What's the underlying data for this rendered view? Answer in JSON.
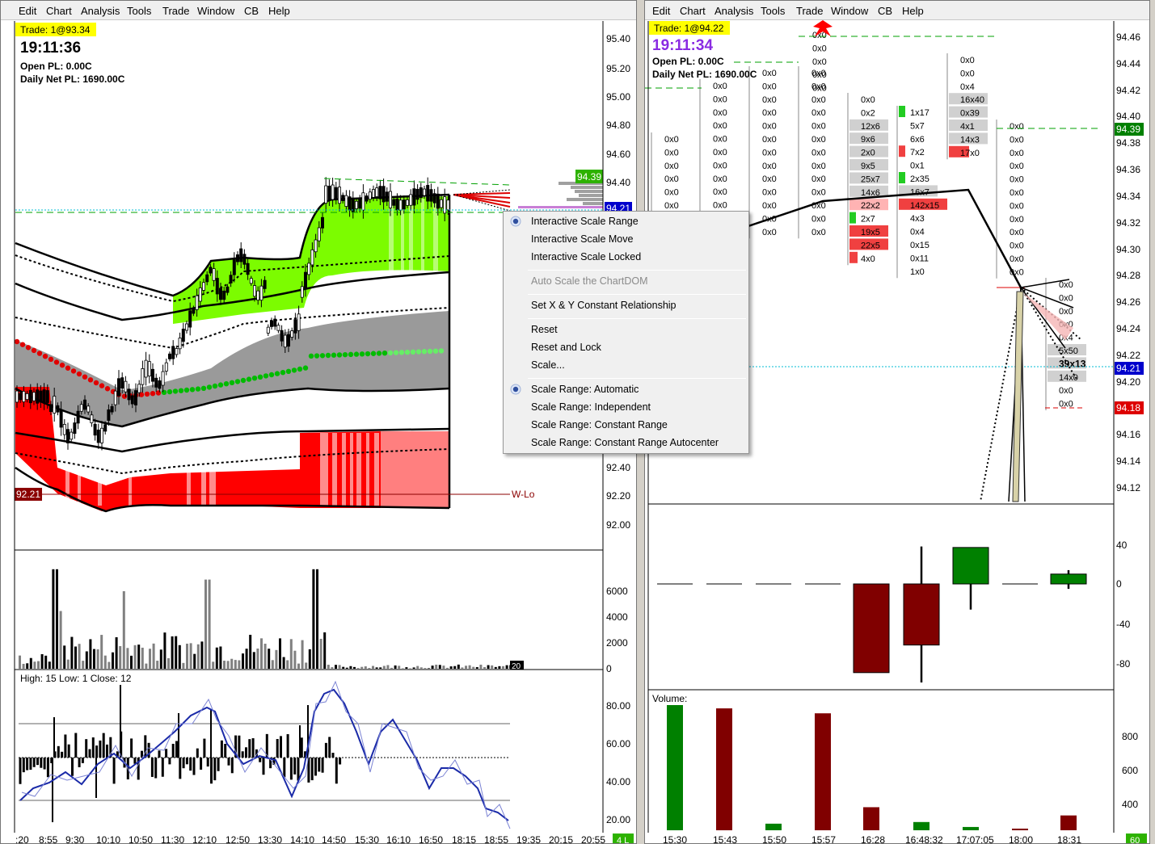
{
  "left_window": {
    "menu": [
      "Edit",
      "Chart",
      "Analysis",
      "Tools",
      "Trade",
      "Window",
      "CB",
      "Help"
    ],
    "trade_badge": "Trade: 1@93.34",
    "clock": "19:11:36",
    "open_pl": "Open PL: 0.00C",
    "daily_net_pl": "Daily Net PL: 1690.00C",
    "price_axis": [
      "95.40",
      "95.20",
      "95.00",
      "94.80",
      "94.60",
      "94.40",
      "92.40",
      "92.20",
      "92.00"
    ],
    "price_badge_green": "94.39",
    "price_badge_blue": "94.21",
    "left_axis_badge": "92.21",
    "wlo_label": "W-Lo",
    "volume_axis": [
      "6000",
      "4000",
      "2000",
      "0"
    ],
    "volume_badge": "20",
    "osc_header": "High: 15   Low: 1   Close: 12",
    "osc_axis": [
      "80.00",
      "60.00",
      "40.00",
      "20.00"
    ],
    "time_axis": [
      ":20",
      "8:55",
      "9:30",
      "10:10",
      "10:50",
      "11:30",
      "12:10",
      "12:50",
      "13:30",
      "14:10",
      "14:50",
      "15:30",
      "16:10",
      "16:50",
      "18:15",
      "18:55",
      "19:35",
      "20:15",
      "20:55"
    ],
    "status_badge": "4 L"
  },
  "right_window": {
    "menu": [
      "Edit",
      "Chart",
      "Analysis",
      "Tools",
      "Trade",
      "Window",
      "CB",
      "Help"
    ],
    "trade_badge": "Trade: 1@94.22",
    "clock": "19:11:34",
    "open_pl": "Open PL: 0.00C",
    "daily_net_pl": "Daily Net PL: 1690.00C",
    "price_axis": [
      "94.46",
      "94.44",
      "94.42",
      "94.40",
      "94.38",
      "94.36",
      "94.34",
      "94.32",
      "94.30",
      "94.28",
      "94.26",
      "94.24",
      "94.22",
      "94.20",
      "94.16",
      "94.14",
      "94.12"
    ],
    "badge_green": "94.39",
    "badge_blue": "94.21",
    "badge_red": "94.18",
    "delta_axis": [
      "40",
      "0",
      "-40",
      "-80"
    ],
    "volume_label": "Volume:",
    "volume_axis": [
      "800",
      "600",
      "400"
    ],
    "time_axis": [
      "15:30",
      "15:43",
      "15:50",
      "15:57",
      "16:28",
      "16:48:32",
      "17:07:05",
      "18:00",
      "18:31"
    ],
    "status_badge": "60",
    "footprint_columns": [
      {
        "cells": [
          "0x0",
          "0x0",
          "0x0",
          "0x0",
          "0x0",
          "0x0"
        ]
      },
      {
        "cells": [
          "0x0",
          "0x0",
          "0x0",
          "0x0",
          "0x0",
          "0x0",
          "0x0",
          "0x0",
          "0x0",
          "0x0",
          "0x0"
        ]
      },
      {
        "cells": [
          "0x0",
          "0x0",
          "0x0",
          "0x0",
          "0x0",
          "0x0",
          "0x0",
          "0x0",
          "0x0",
          "0x0",
          "0x0",
          "0x0",
          "0x0"
        ]
      },
      {
        "cells": [
          "0x0",
          "0x0",
          "0x0",
          "0x0",
          "0x0",
          "0x0",
          "0x0",
          "0x0",
          "0x0",
          "0x0",
          "0x0",
          "0x0",
          "0x0"
        ]
      },
      {
        "cells": [
          "0x0",
          "0x2",
          "12x6",
          "9x6",
          "2x0",
          "9x5",
          "25x7",
          "14x6",
          "22x2",
          "2x7",
          "19x5",
          "22x5",
          "4x0"
        ]
      },
      {
        "cells": [
          "1x17",
          "5x7",
          "6x6",
          "7x2",
          "0x1",
          "2x35",
          "16x7",
          "142x15",
          "4x3",
          "0x4",
          "0x15",
          "0x11",
          "1x0"
        ]
      },
      {
        "cells": [
          "0x0",
          "0x0",
          "0x4",
          "16x40",
          "0x39",
          "4x1",
          "14x3",
          "17x0"
        ]
      },
      {
        "cells": [
          "0x0",
          "0x0",
          "0x0",
          "0x0",
          "0x0",
          "0x0",
          "0x0",
          "0x0",
          "0x0",
          "0x0",
          "0x0",
          "0x0"
        ]
      },
      {
        "cells": [
          "0x0",
          "0x0",
          "0x0",
          "0x0",
          "0x4",
          "5x50",
          "39x13",
          "14x0",
          "0x0",
          "0x0"
        ]
      }
    ],
    "top_column": [
      "0x0",
      "0x0",
      "0x0",
      "0x0",
      "0x0"
    ]
  },
  "context_menu": {
    "items": [
      {
        "label": "Interactive Scale Range",
        "checked": true,
        "disabled": false
      },
      {
        "label": "Interactive Scale Move",
        "checked": false,
        "disabled": false
      },
      {
        "label": "Interactive Scale Locked",
        "checked": false,
        "disabled": false
      },
      {
        "label": "Auto Scale the ChartDOM",
        "checked": false,
        "disabled": true
      },
      {
        "label": "Set X & Y Constant Relationship",
        "checked": false,
        "disabled": false
      },
      {
        "label": "Reset",
        "checked": false,
        "disabled": false
      },
      {
        "label": "Reset and Lock",
        "checked": false,
        "disabled": false
      },
      {
        "label": "Scale...",
        "checked": false,
        "disabled": false
      },
      {
        "label": "Scale Range: Automatic",
        "checked": true,
        "disabled": false
      },
      {
        "label": "Scale Range: Independent",
        "checked": false,
        "disabled": false
      },
      {
        "label": "Scale Range: Constant Range",
        "checked": false,
        "disabled": false
      },
      {
        "label": "Scale Range: Constant Range Autocenter",
        "checked": false,
        "disabled": false
      }
    ]
  },
  "chart_data": [
    {
      "type": "bar",
      "title": "",
      "categories": [
        "15:30",
        "15:43",
        "15:50",
        "15:57",
        "16:28",
        "16:48:32",
        "17:07:05",
        "18:00",
        "18:31"
      ],
      "series": [
        {
          "values": [
            960,
            940,
            240,
            910,
            340,
            250,
            220,
            210,
            290
          ]
        }
      ],
      "colors": [
        "#008000",
        "#800000",
        "#008000",
        "#800000",
        "#800000",
        "#008000",
        "#008000",
        "#800000",
        "#800000"
      ],
      "ylim": [
        200,
        1000
      ]
    },
    {
      "type": "candlestick",
      "title": "",
      "categories": [
        "15:30",
        "15:43",
        "15:50",
        "15:57",
        "16:28",
        "16:48:32",
        "17:07:05",
        "18:00",
        "18:31"
      ],
      "series": [
        {
          "open": [
            0,
            0,
            0,
            0,
            0,
            0,
            0,
            0,
            0
          ],
          "close": [
            0,
            0,
            0,
            0,
            -90,
            -62,
            37,
            0,
            10
          ],
          "high": [
            0,
            0,
            0,
            0,
            0,
            38,
            37,
            0,
            14
          ],
          "low": [
            0,
            0,
            0,
            0,
            -90,
            -100,
            -26,
            0,
            -5
          ]
        }
      ],
      "ylim": [
        -100,
        50
      ]
    }
  ]
}
